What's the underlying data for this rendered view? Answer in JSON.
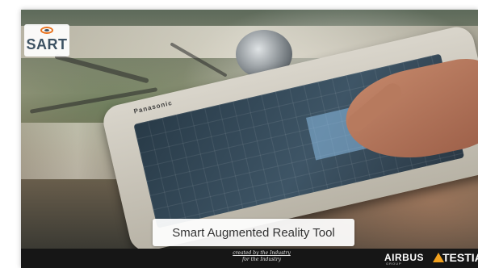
{
  "logo": {
    "text": "SART"
  },
  "photo": {
    "tablet_brand": "Panasonic"
  },
  "caption": {
    "text": "Smart Augmented Reality Tool"
  },
  "footer": {
    "tagline_line1": "created by the Industry",
    "tagline_line2": "for the Industry",
    "partner1_name": "AIRBUS",
    "partner1_sub": "GROUP",
    "partner2_name": "TESTIA"
  },
  "colors": {
    "footer_bg": "#161616",
    "logo_accent": "#e8731e",
    "logo_text": "#3e5363",
    "testia_accent": "#f2a11e"
  }
}
